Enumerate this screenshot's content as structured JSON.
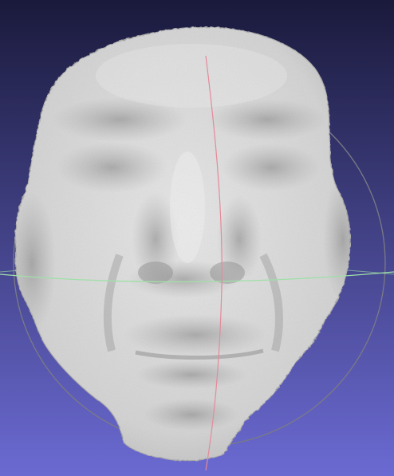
{
  "viewer": {
    "background_top": "#1a1a3c",
    "background_bottom": "#6b6ad2",
    "mesh_color": "#d9d9d9",
    "mesh_shadow": "#8f8f8f",
    "trackball_ring_color": "#7a7a86",
    "trackball_horizontal_color": "#9fe0a8",
    "trackball_vertical_color": "#e48a9a",
    "model": "face-mesh"
  }
}
